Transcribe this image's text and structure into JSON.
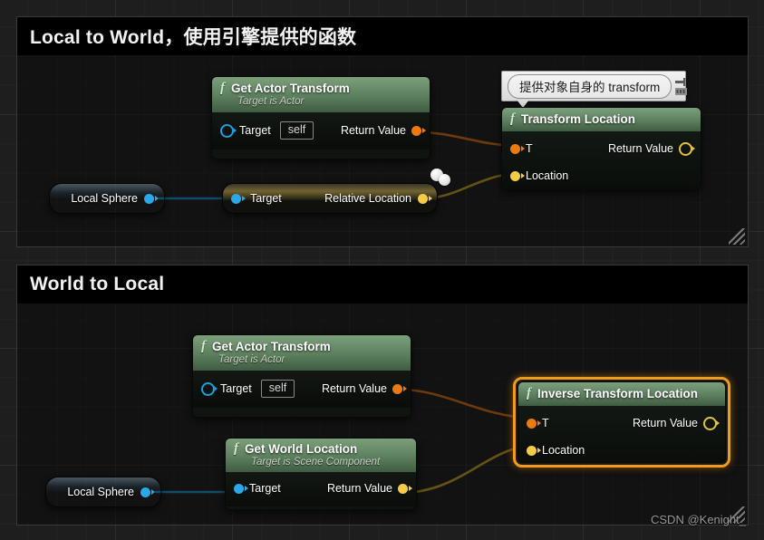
{
  "app": {
    "title": "Unreal Engine Blueprint Graph",
    "watermark": "CSDN @Kenight_"
  },
  "colors": {
    "wire_transform": "#e8760f",
    "wire_vector": "#d4ab24",
    "wire_object": "#1c9fe0",
    "node_header_green": "#5c7f5e",
    "selection_orange": "#f29b18",
    "canvas_bg": "#1e1e1e",
    "comment_bar": "#000000"
  },
  "comments": [
    {
      "id": "local-to-world",
      "title": "Local to World，使用引擎提供的函数"
    },
    {
      "id": "world-to-local",
      "title": "World to Local"
    }
  ],
  "bubble": {
    "text": "提供对象自身的 transform",
    "pin_icon": "pin-icon"
  },
  "nodes": [
    {
      "id": "get-actor-transform-1",
      "title": "Get Actor Transform",
      "subtitle": "Target is Actor",
      "fn_icon": "f",
      "inputs": [
        {
          "label": "Target",
          "pin": "object",
          "value": "self"
        }
      ],
      "outputs": [
        {
          "label": "Return Value",
          "pin": "transform"
        }
      ]
    },
    {
      "id": "transform-location",
      "title": "Transform Location",
      "subtitle": "",
      "fn_icon": "f",
      "inputs": [
        {
          "label": "T",
          "pin": "transform"
        },
        {
          "label": "Location",
          "pin": "vector"
        }
      ],
      "outputs": [
        {
          "label": "Return Value",
          "pin": "vector-hollow"
        }
      ]
    },
    {
      "id": "local-sphere-1",
      "title": "Local Sphere",
      "type": "variable",
      "outputs": [
        {
          "label": "",
          "pin": "object-filled"
        }
      ]
    },
    {
      "id": "relative-location",
      "title": "",
      "type": "compact",
      "inputs": [
        {
          "label": "Target",
          "pin": "object-filled"
        }
      ],
      "outputs": [
        {
          "label": "Relative Location",
          "pin": "vector"
        }
      ]
    },
    {
      "id": "get-actor-transform-2",
      "title": "Get Actor Transform",
      "subtitle": "Target is Actor",
      "fn_icon": "f",
      "inputs": [
        {
          "label": "Target",
          "pin": "object",
          "value": "self"
        }
      ],
      "outputs": [
        {
          "label": "Return Value",
          "pin": "transform"
        }
      ]
    },
    {
      "id": "inverse-transform-location",
      "title": "Inverse Transform Location",
      "subtitle": "",
      "fn_icon": "f",
      "selected": true,
      "inputs": [
        {
          "label": "T",
          "pin": "transform"
        },
        {
          "label": "Location",
          "pin": "vector"
        }
      ],
      "outputs": [
        {
          "label": "Return Value",
          "pin": "vector-hollow"
        }
      ]
    },
    {
      "id": "get-world-location",
      "title": "Get World Location",
      "subtitle": "Target is Scene Component",
      "fn_icon": "f",
      "inputs": [
        {
          "label": "Target",
          "pin": "object-filled"
        }
      ],
      "outputs": [
        {
          "label": "Return Value",
          "pin": "vector"
        }
      ]
    },
    {
      "id": "local-sphere-2",
      "title": "Local Sphere",
      "type": "variable",
      "outputs": [
        {
          "label": "",
          "pin": "object-filled"
        }
      ]
    }
  ],
  "labels": {
    "target": "Target",
    "return_value": "Return Value",
    "t": "T",
    "location": "Location",
    "relative_location": "Relative Location",
    "self_value": "self",
    "target_is_actor": "Target is Actor",
    "target_is_scene_component": "Target is Scene Component"
  }
}
